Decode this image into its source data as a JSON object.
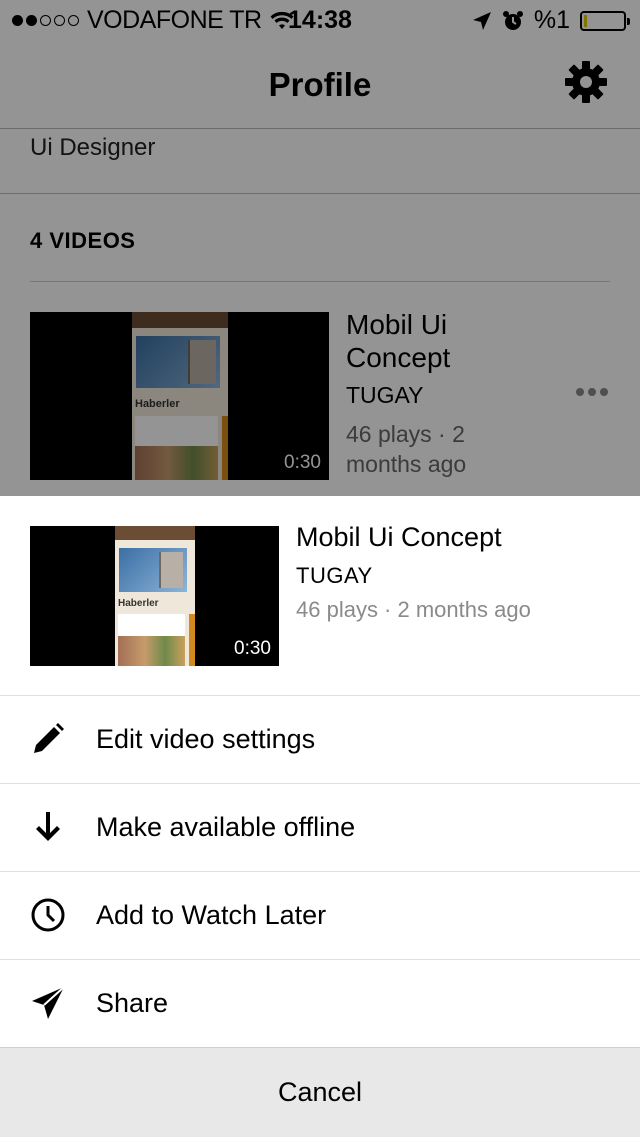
{
  "status_bar": {
    "carrier": "VODAFONE TR",
    "signal_dots_filled": 2,
    "signal_dots_total": 5,
    "time": "14:38",
    "battery": "%1",
    "battery_level_percent": 1,
    "icons": [
      "wifi-icon",
      "location-arrow-icon",
      "alarm-clock-icon"
    ]
  },
  "nav": {
    "title": "Profile",
    "settings_icon": "gear-icon"
  },
  "profile": {
    "role": "Ui Designer"
  },
  "videos_section": {
    "heading": "4 VIDEOS",
    "items": [
      {
        "title": "Mobil Ui Concept",
        "channel": "TUGAY",
        "meta": "46 plays · 2 months ago",
        "duration": "0:30",
        "thumb_heading": "Haberler"
      }
    ]
  },
  "sheet": {
    "video": {
      "title": "Mobil Ui Concept",
      "channel": "TUGAY",
      "meta": "46 plays · 2 months ago",
      "duration": "0:30",
      "thumb_heading": "Haberler"
    },
    "actions": [
      {
        "label": "Edit video settings",
        "icon": "pencil-icon"
      },
      {
        "label": "Make available offline",
        "icon": "download-arrow-icon"
      },
      {
        "label": "Add to Watch Later",
        "icon": "clock-icon"
      },
      {
        "label": "Share",
        "icon": "paper-plane-icon"
      }
    ],
    "cancel_label": "Cancel"
  },
  "colors": {
    "overlay": "#000000",
    "cancel_bg": "#e8e8e8",
    "meta_text": "#8a8a8a",
    "battery_fill": "#e6c700"
  }
}
